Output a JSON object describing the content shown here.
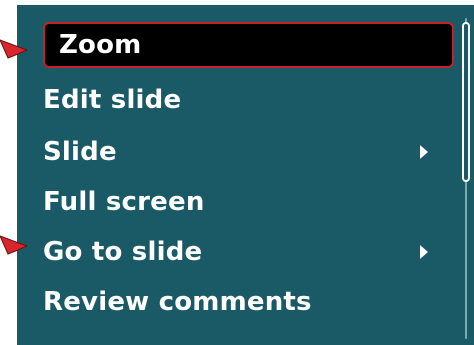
{
  "menu": {
    "items": [
      {
        "label": "Zoom",
        "selected": true,
        "has_submenu": false
      },
      {
        "label": "Edit slide",
        "selected": false,
        "has_submenu": false
      },
      {
        "label": "Slide",
        "selected": false,
        "has_submenu": true
      },
      {
        "label": "Full screen",
        "selected": false,
        "has_submenu": false
      },
      {
        "label": "Go to slide",
        "selected": false,
        "has_submenu": true
      },
      {
        "label": "Review comments",
        "selected": false,
        "has_submenu": false
      }
    ],
    "scroll_position": 0.0
  },
  "colors": {
    "menu_background": "#1a5966",
    "selection_background": "#000000",
    "selection_border": "#c8202a",
    "text": "#ffffff",
    "callout_arrow": "#d8262e"
  },
  "icons": {
    "submenu_indicator": "chevron-right-icon",
    "callout": "callout-arrow-icon"
  }
}
